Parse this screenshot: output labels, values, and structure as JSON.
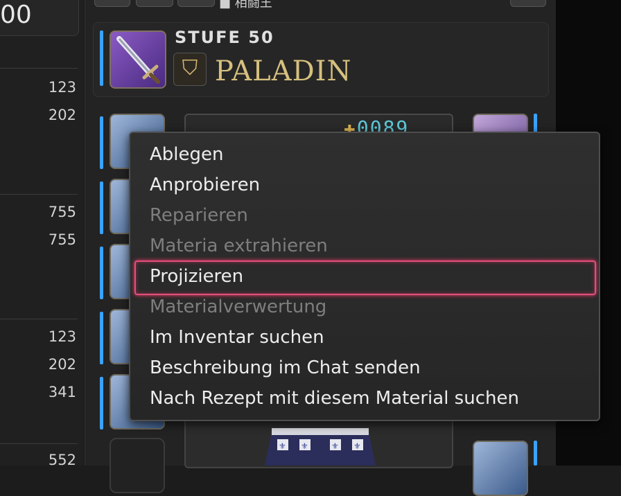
{
  "left_panel": {
    "top_value": "00",
    "stats": [
      {
        "value": "123"
      },
      {
        "value": "202"
      },
      {
        "value": "755"
      },
      {
        "value": "755"
      },
      {
        "value": "123"
      },
      {
        "value": "202"
      },
      {
        "value": "341"
      },
      {
        "value": "552"
      }
    ]
  },
  "header": {
    "level_label": "STUFE 50",
    "job_name": "PALADIN",
    "top_text": "■ 相闘王"
  },
  "item": {
    "ilvl": "0089"
  },
  "context_menu": {
    "items": [
      {
        "label": "Ablegen",
        "enabled": true
      },
      {
        "label": "Anprobieren",
        "enabled": true
      },
      {
        "label": "Reparieren",
        "enabled": false
      },
      {
        "label": "Materia extrahieren",
        "enabled": false
      },
      {
        "label": "Projizieren",
        "enabled": true,
        "selected": true
      },
      {
        "label": "Materialverwertung",
        "enabled": false
      },
      {
        "label": "Im Inventar suchen",
        "enabled": true
      },
      {
        "label": "Beschreibung im Chat senden",
        "enabled": true
      },
      {
        "label": "Nach Rezept mit diesem Material suchen",
        "enabled": true
      }
    ]
  },
  "colors": {
    "accent_blue": "#3aa2ff",
    "selection_border": "#e0507a",
    "job_gold": "#d6c07e",
    "ilvl_cyan": "#5ec8d8"
  }
}
